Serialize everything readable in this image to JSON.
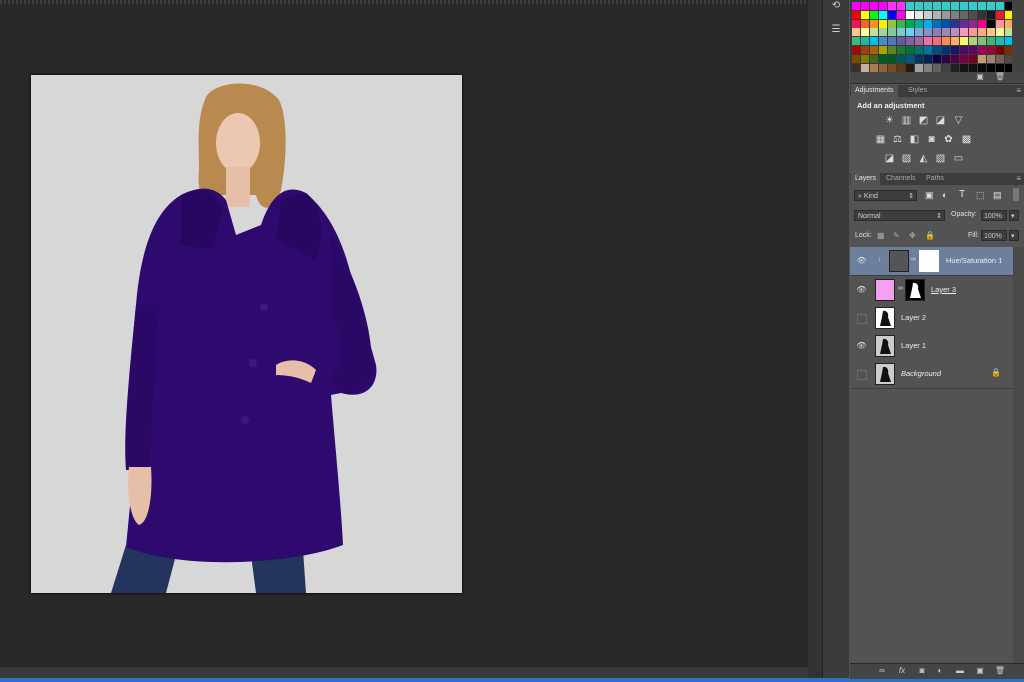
{
  "swatches": {
    "rows": [
      [
        "#ff00ff",
        "#ff00ff",
        "#ff00ff",
        "#ff00ff",
        "#ff33ff",
        "#ff33ff",
        "#33cccc",
        "#33cccc",
        "#33cccc",
        "#33cccc",
        "#33cccc",
        "#33cccc",
        "#33cccc",
        "#33cccc",
        "#33cccc",
        "#33cccc",
        "#33cccc",
        "#000000"
      ],
      [
        "#ff0000",
        "#ffff00",
        "#00ff00",
        "#00ffff",
        "#0000ff",
        "#ff00ff",
        "#ffffff",
        "#e6e6e6",
        "#cccccc",
        "#b3b3b3",
        "#999999",
        "#808080",
        "#666666",
        "#4d4d4d",
        "#333333",
        "#1a1a1a",
        "#ed1c24",
        "#fff200"
      ],
      [
        "#ed145b",
        "#f26522",
        "#f7941d",
        "#fff200",
        "#8dc63f",
        "#39b54a",
        "#00a651",
        "#00a99d",
        "#00aeef",
        "#0072bc",
        "#0054a6",
        "#2e3192",
        "#662d91",
        "#92278f",
        "#ec008c",
        "#000000",
        "#f5989d",
        "#fbaf5d"
      ],
      [
        "#fdc689",
        "#fff799",
        "#c4df9b",
        "#a3d39c",
        "#82ca9c",
        "#7accc8",
        "#6dcff6",
        "#7da7d9",
        "#8393ca",
        "#8781bd",
        "#a186be",
        "#bc8dbf",
        "#f49ac2",
        "#f6989d",
        "#f9ad81",
        "#fdc68a",
        "#fff79a",
        "#c4df9b"
      ],
      [
        "#3cb878",
        "#1abc9c",
        "#00bff3",
        "#448ccb",
        "#5674b9",
        "#605ca8",
        "#855fa8",
        "#a864a8",
        "#f06eaa",
        "#f26d7d",
        "#f68e56",
        "#fbaf5d",
        "#fff467",
        "#acd373",
        "#7cc576",
        "#3bb878",
        "#1cbbb4",
        "#00bff3"
      ],
      [
        "#9e0b0f",
        "#a0410d",
        "#a36209",
        "#aba000",
        "#598527",
        "#1a7b30",
        "#007236",
        "#00746b",
        "#0076a3",
        "#004b80",
        "#003471",
        "#1b1464",
        "#440e62",
        "#630460",
        "#9e005d",
        "#9e0039",
        "#790000",
        "#7b2e00"
      ],
      [
        "#7d4900",
        "#827b00",
        "#406618",
        "#005e20",
        "#005826",
        "#005952",
        "#005b7f",
        "#003663",
        "#002157",
        "#0d004c",
        "#32004b",
        "#4b0049",
        "#7b0046",
        "#7a0026",
        "#c69c6d",
        "#998675",
        "#736357",
        "#534741"
      ],
      [
        "#37302a",
        "#c7b299",
        "#a67c52",
        "#8c6239",
        "#754c24",
        "#603913",
        "#2a1a0e",
        "#a0a0a0",
        "#808080",
        "#606060",
        "#404040",
        "#202020",
        "#151515",
        "#101010",
        "#0a0a0a",
        "#050505",
        "#000000",
        "#000000"
      ]
    ]
  },
  "adjustments": {
    "tabs": [
      "Adjustments",
      "Styles"
    ],
    "title": "Add an adjustment",
    "row1": [
      "brightness-icon",
      "levels-icon",
      "curves-icon",
      "exposure-icon",
      "gradient-triangle-icon"
    ],
    "row2": [
      "vibrance-icon",
      "hue-sat-icon",
      "color-balance-icon",
      "bw-icon",
      "photo-filter-icon",
      "channel-mixer-icon",
      "color-lookup-icon"
    ],
    "row3": [
      "invert-icon",
      "posterize-icon",
      "threshold-icon",
      "selective-color-icon",
      "gradient-map-icon"
    ]
  },
  "layers": {
    "tabs": [
      "Layers",
      "Channels",
      "Paths"
    ],
    "filter_kind": "Kind",
    "blend_mode": "Normal",
    "opacity_label": "Opacity:",
    "opacity_value": "100%",
    "lock_label": "Lock:",
    "fill_label": "Fill:",
    "fill_value": "100%",
    "items": [
      {
        "name": "Hue/Saturation 1",
        "visible": true,
        "selected": true
      },
      {
        "name": "Layer 3",
        "visible": true,
        "selected": false
      },
      {
        "name": "Layer 2",
        "visible": false,
        "selected": false
      },
      {
        "name": "Layer 1",
        "visible": true,
        "selected": false
      },
      {
        "name": "Background",
        "visible": false,
        "selected": false
      }
    ]
  },
  "colors": {
    "coat": "#2e0a6e",
    "selected_layer": "#6c7f9c",
    "layer3_thumb": "#f5a0f0"
  }
}
